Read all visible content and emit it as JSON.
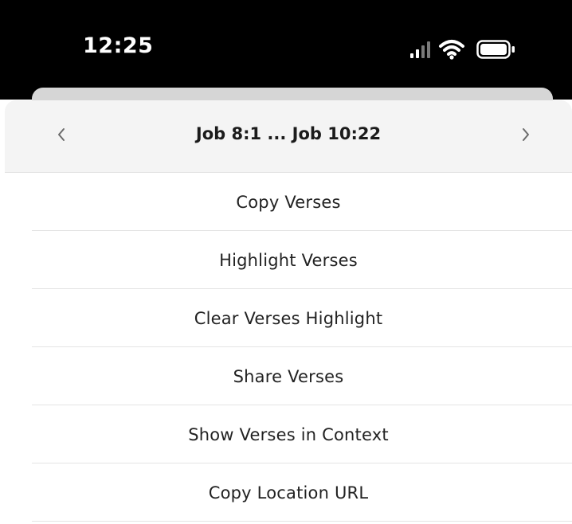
{
  "status_bar": {
    "time": "12:25",
    "signal_icon": "cellular-signal-icon",
    "wifi_icon": "wifi-icon",
    "battery_icon": "battery-icon"
  },
  "sheet": {
    "header": {
      "title": "Job 8:1 ... Job 10:22",
      "prev_icon": "chevron-left-icon",
      "next_icon": "chevron-right-icon"
    },
    "menu": {
      "items": [
        {
          "label": "Copy Verses"
        },
        {
          "label": "Highlight Verses"
        },
        {
          "label": "Clear Verses Highlight"
        },
        {
          "label": "Share Verses"
        },
        {
          "label": "Show Verses in Context"
        },
        {
          "label": "Copy Location URL"
        }
      ]
    }
  },
  "colors": {
    "status_bar_bg": "#000000",
    "header_bg": "#f4f4f4",
    "divider": "#e4e4e4",
    "text": "#222222"
  }
}
